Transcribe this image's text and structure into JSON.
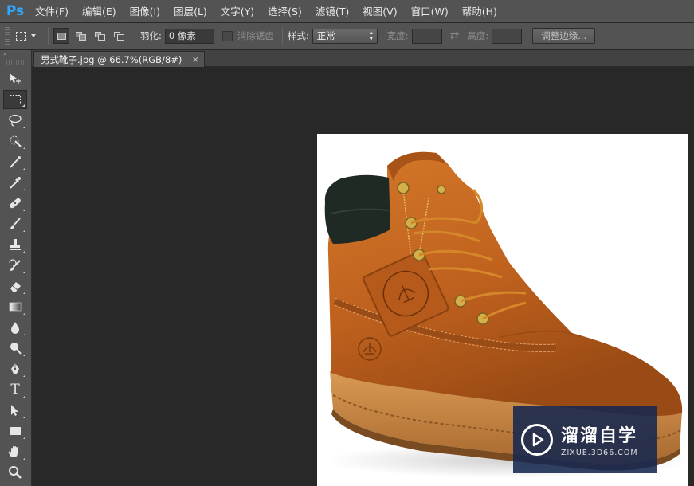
{
  "app": {
    "logo": "Ps"
  },
  "menu": [
    "文件(F)",
    "编辑(E)",
    "图像(I)",
    "图层(L)",
    "文字(Y)",
    "选择(S)",
    "滤镜(T)",
    "视图(V)",
    "窗口(W)",
    "帮助(H)"
  ],
  "options": {
    "feather_label": "羽化:",
    "feather_value": "0 像素",
    "antialias_label": "消除锯齿",
    "style_label": "样式:",
    "style_value": "正常",
    "width_label": "宽度:",
    "height_label": "高度:",
    "refine_edge_button": "调整边缘..."
  },
  "document": {
    "tab_title": "男式靴子.jpg @ 66.7%(RGB/8#)",
    "close_glyph": "×"
  },
  "toolbar": {
    "collapse_glyph": "»",
    "tools": [
      "move-tool",
      "rectangular-marquee-tool",
      "lasso-tool",
      "quick-selection-tool",
      "crop-tool",
      "eyedropper-tool",
      "spot-healing-brush-tool",
      "brush-tool",
      "clone-stamp-tool",
      "history-brush-tool",
      "eraser-tool",
      "gradient-tool",
      "blur-tool",
      "dodge-tool",
      "pen-tool",
      "type-tool",
      "path-selection-tool",
      "rectangle-tool",
      "hand-tool",
      "zoom-tool"
    ],
    "type_tool_glyph": "T"
  },
  "watermark": {
    "title": "溜溜自学",
    "url": "ZIXUE.3D66.COM"
  },
  "colors": {
    "ps_blue": "#31a8ff",
    "panel": "#535353",
    "canvas_bg": "#282828",
    "boot_leather": "#c1661f",
    "boot_collar": "#1f2a24"
  }
}
